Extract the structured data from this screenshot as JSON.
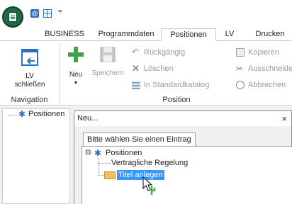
{
  "colors": {
    "brand_green": "#1f6b45",
    "accent_blue": "#2a6fc2",
    "selection": "#3399ff"
  },
  "quick_access": {
    "icons": [
      "app-orb-icon",
      "email-icon",
      "grid-icon",
      "more-icon"
    ]
  },
  "tabs": [
    {
      "label": "BUSINESS"
    },
    {
      "label": "Programmdaten"
    },
    {
      "label": "Positionen",
      "active": true
    },
    {
      "label": "LV"
    },
    {
      "label": "Drucken"
    }
  ],
  "ribbon": {
    "navigation": {
      "group_label": "Navigation",
      "lv_schliessen": {
        "line1": "LV",
        "line2": "schließen"
      }
    },
    "position": {
      "group_label": "Position",
      "neu": {
        "label": "Neu"
      },
      "speichern": {
        "label": "Speichern"
      },
      "rueckgaengig": "Rückgängig",
      "loeschen": "Löschen",
      "in_standardkatalog": "In Standardkatalog",
      "kopieren": "Kopieren",
      "ausschneiden": "Ausschneide",
      "abbrechen": "Abbrechen"
    }
  },
  "left_tree": {
    "root": "Positionen"
  },
  "dialog": {
    "title": "Neu...",
    "close": "×",
    "tab": "Bitte wählen Sie einen Eintrag",
    "tree": {
      "expander": "⊟",
      "root": "Positionen",
      "items": [
        "Vertragliche Regelung",
        "Titel anlegen"
      ],
      "selected_index": 1
    }
  }
}
